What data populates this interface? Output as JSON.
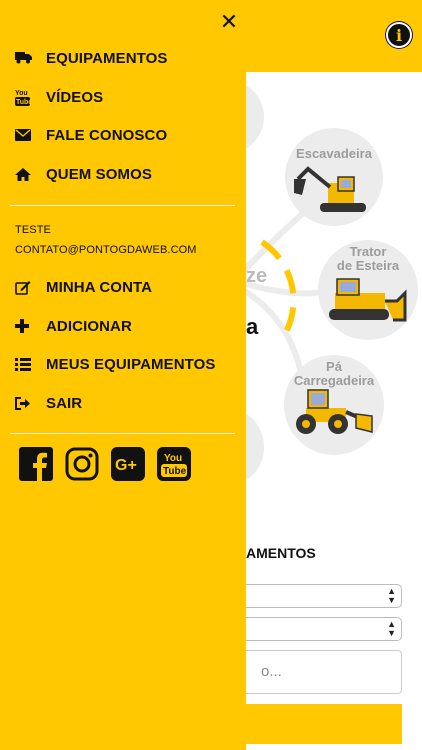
{
  "colors": {
    "accent": "#ffc800",
    "text": "#111111",
    "muted": "#9c9c9c"
  },
  "drawer": {
    "close_icon": "✕",
    "main_menu": [
      {
        "icon": "truck-icon",
        "label": "EQUIPAMENTOS"
      },
      {
        "icon": "youtube-icon",
        "label": "VÍDEOS"
      },
      {
        "icon": "envelope-icon",
        "label": "FALE CONOSCO"
      },
      {
        "icon": "home-icon",
        "label": "QUEM SOMOS"
      }
    ],
    "user": {
      "name": "TESTE",
      "email": "CONTATO@PONTOGDAWEB.COM"
    },
    "account_menu": [
      {
        "icon": "edit-icon",
        "label": "MINHA CONTA"
      },
      {
        "icon": "plus-icon",
        "label": "ADICIONAR"
      },
      {
        "icon": "list-icon",
        "label": "MEUS EQUIPAMENTOS"
      },
      {
        "icon": "sign-out-icon",
        "label": "SAIR"
      }
    ],
    "social": [
      "facebook-icon",
      "instagram-icon",
      "google-plus-icon",
      "youtube-icon"
    ]
  },
  "background": {
    "info_icon": "i",
    "equipment": [
      {
        "label": "Escavadeira"
      },
      {
        "label": "Trator\nde Esteira"
      },
      {
        "label": "Pá\nCarregadeira"
      }
    ],
    "partial_text_left": "a",
    "partial_text_center_1": "ze",
    "partial_text_center_2": "a",
    "section_title": "AMENTOS",
    "search_placeholder": "o..."
  }
}
